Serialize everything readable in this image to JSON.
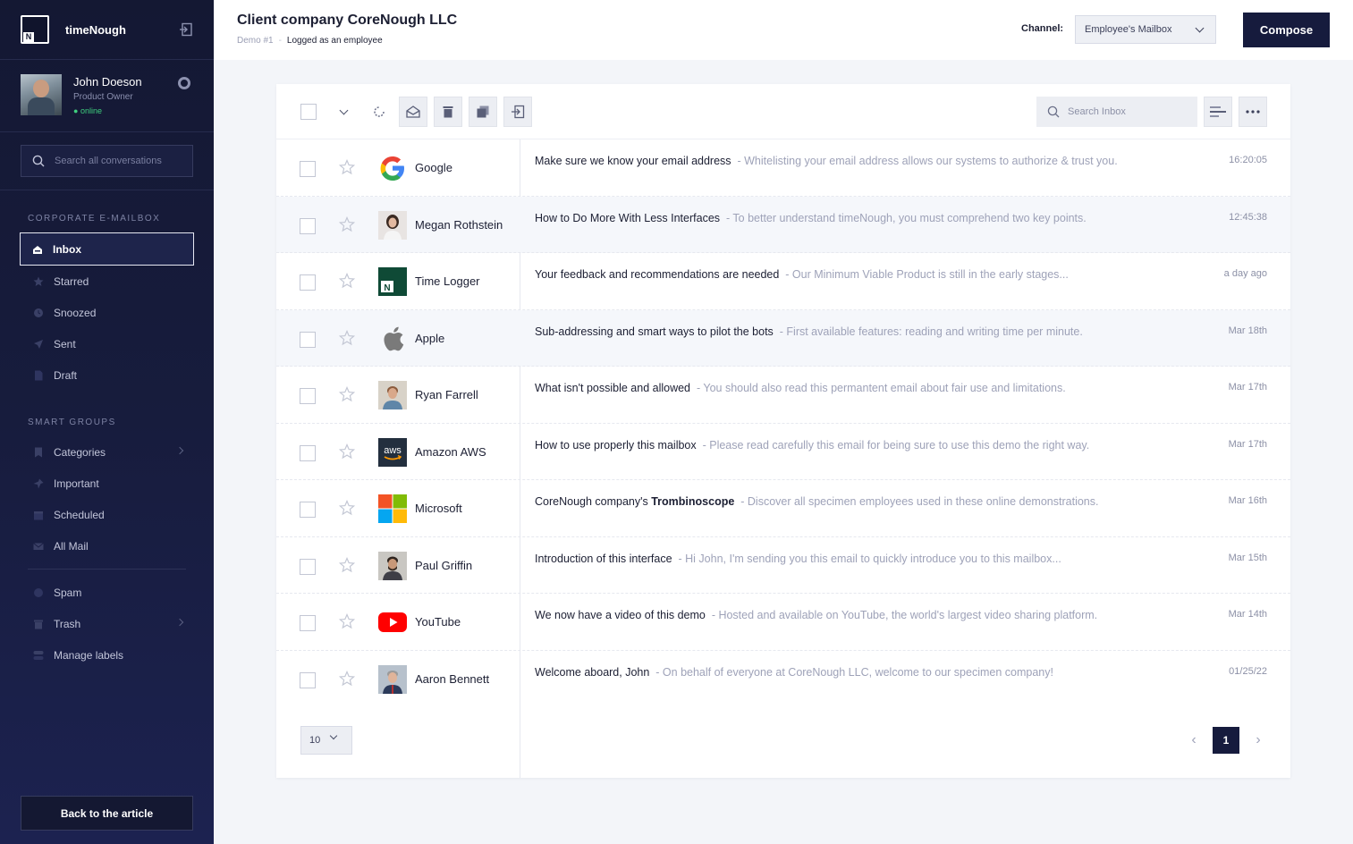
{
  "brand": {
    "name": "timeNough"
  },
  "user": {
    "name": "John Doeson",
    "role": "Product Owner",
    "status": "online"
  },
  "sidebar_search": {
    "placeholder": "Search all conversations"
  },
  "sections": {
    "mailbox": {
      "heading": "CORPORATE E-MAILBOX",
      "items": [
        "Inbox",
        "Starred",
        "Snoozed",
        "Sent",
        "Draft"
      ]
    },
    "smart": {
      "heading": "SMART GROUPS",
      "items": [
        "Categories",
        "Important",
        "Scheduled",
        "All Mail"
      ]
    },
    "other": {
      "items": [
        "Spam",
        "Trash",
        "Manage labels"
      ]
    }
  },
  "back_button": "Back to the article",
  "header": {
    "title": "Client company CoreNough LLC",
    "crumb_demo": "Demo #1",
    "crumb_current": "Logged as an employee",
    "channel_label": "Channel:",
    "channel_value": "Employee's Mailbox",
    "compose": "Compose"
  },
  "inbox_search": {
    "placeholder": "Search Inbox"
  },
  "emails": [
    {
      "sender": "Google",
      "subject": "Make sure we know your email address",
      "snippet": "- Whitelisting your email address allows our systems to authorize & trust you.",
      "time": "16:20:05",
      "icon": "google-logo"
    },
    {
      "sender": "Megan Rothstein",
      "subject": "How to Do More With Less Interfaces",
      "snippet": "- To better understand timeNough, you must comprehend two key points.",
      "time": "12:45:38",
      "icon": "avatar"
    },
    {
      "sender": "Time Logger",
      "subject": "Your feedback and recommendations are needed",
      "snippet": "- Our Minimum Viable Product is still in the early stages...",
      "time": "a day ago",
      "icon": "timelogger-logo"
    },
    {
      "sender": "Apple",
      "subject": "Sub-addressing and smart ways to pilot the bots",
      "snippet": "- First available features: reading and writing time per minute.",
      "time": "Mar 18th",
      "icon": "apple-logo"
    },
    {
      "sender": "Ryan Farrell",
      "subject": "What isn't possible and allowed",
      "snippet": "- You should also read this permantent email about fair use and limitations.",
      "time": "Mar 17th",
      "icon": "avatar"
    },
    {
      "sender": "Amazon AWS",
      "subject": "How to use properly this mailbox",
      "snippet": "- Please read carefully this email for being sure to use this demo the right way.",
      "time": "Mar 17th",
      "icon": "aws-logo"
    },
    {
      "sender": "Microsoft",
      "subject_pre": "CoreNough company's ",
      "subject_bold": "Trombinoscope",
      "snippet": "- Discover all specimen employees used in these online demonstrations.",
      "time": "Mar 16th",
      "icon": "microsoft-logo"
    },
    {
      "sender": "Paul Griffin",
      "subject": "Introduction of this interface",
      "snippet": "- Hi John, I'm sending you this email to quickly introduce you to this mailbox...",
      "time": "Mar 15th",
      "icon": "avatar"
    },
    {
      "sender": "YouTube",
      "subject": "We now have a video of this demo",
      "snippet": "- Hosted and available on YouTube, the world's largest video sharing platform.",
      "time": "Mar 14th",
      "icon": "youtube-logo"
    },
    {
      "sender": "Aaron Bennett",
      "subject": "Welcome aboard, John",
      "snippet": "- On behalf of everyone at CoreNough LLC, welcome to our specimen company!",
      "time": "01/25/22",
      "icon": "avatar"
    }
  ],
  "pagination": {
    "per_page": "10",
    "current": "1"
  },
  "colors": {
    "sidebar": "#161b3d",
    "accent": "#161b3d",
    "online": "#3fcf7e"
  }
}
